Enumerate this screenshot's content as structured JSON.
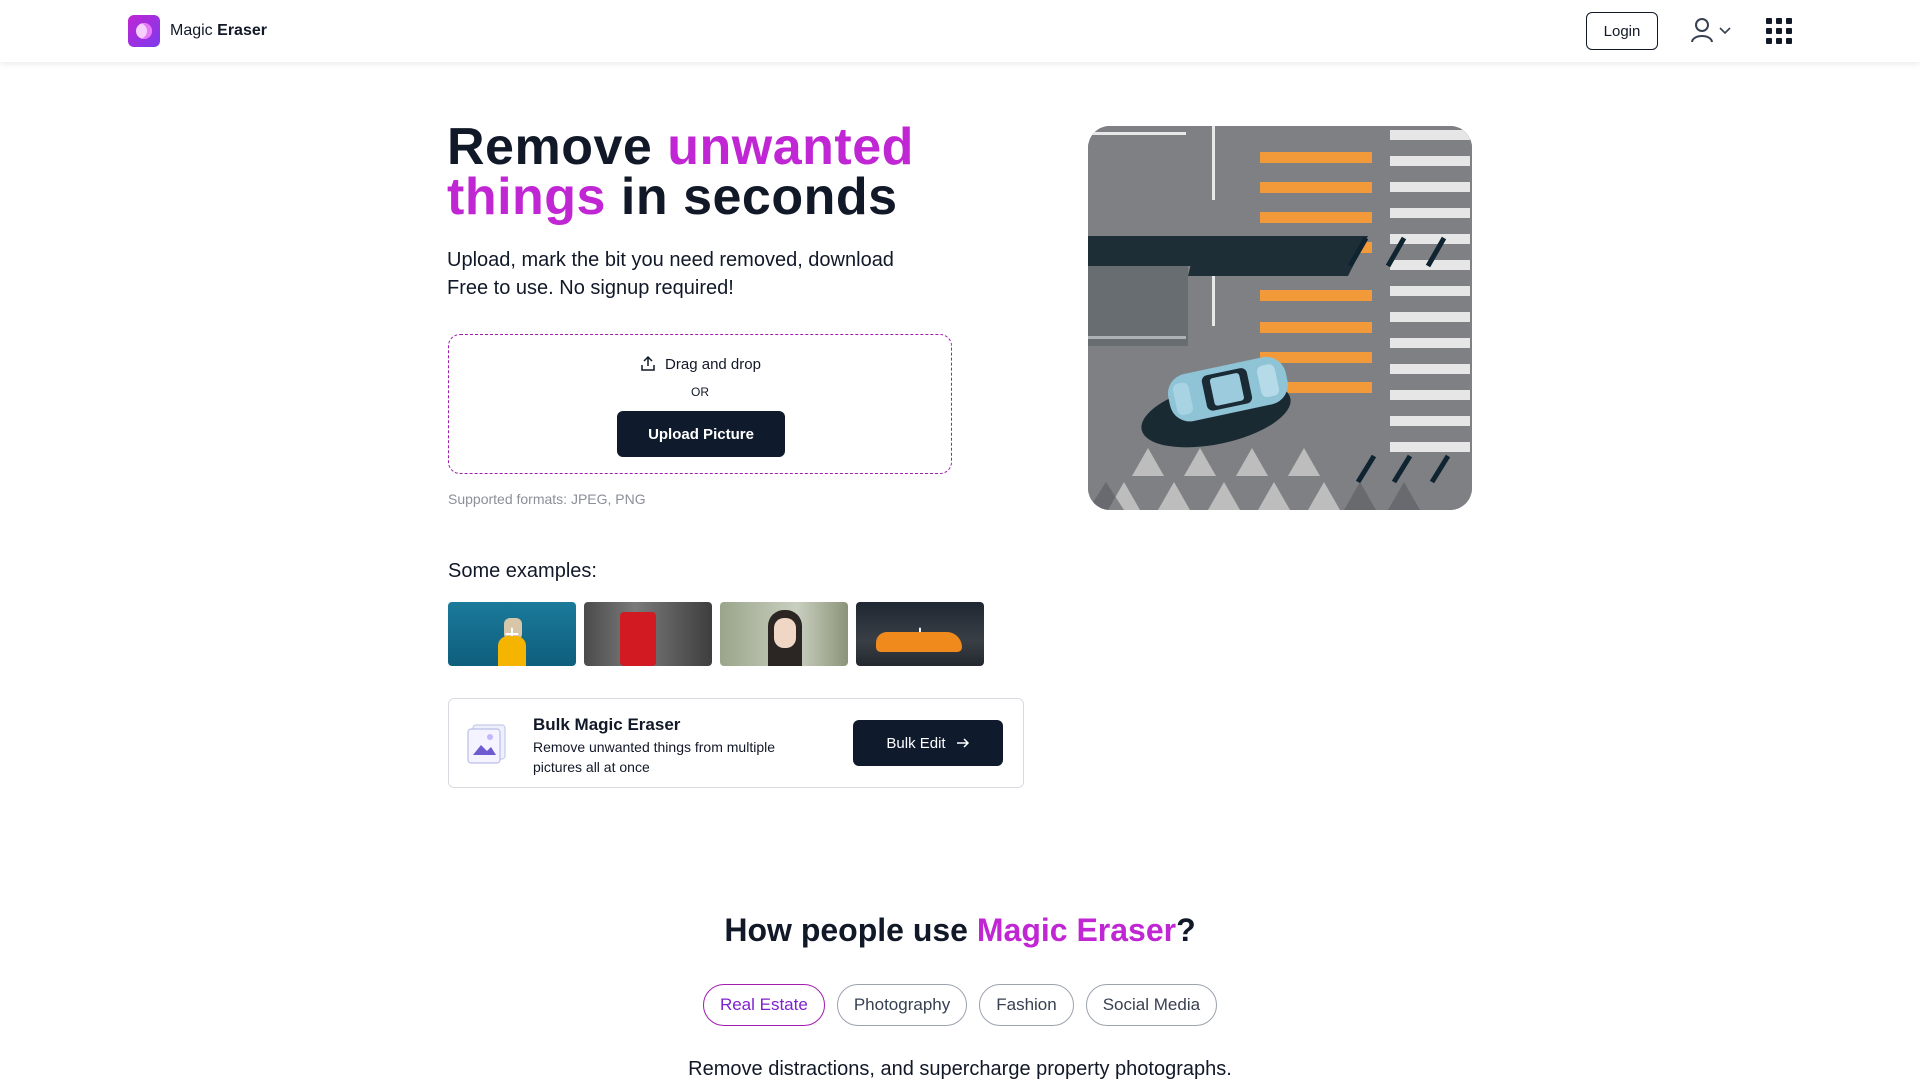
{
  "header": {
    "brand_magic": "Magic",
    "brand_eraser": "Eraser",
    "login_label": "Login"
  },
  "hero": {
    "title_part1": "Remove ",
    "title_accent1": "unwanted",
    "title_accent2": "things",
    "title_part2": " in seconds",
    "subtitle_line1": "Upload, mark the bit you need removed, download",
    "subtitle_line2": "Free to use. No signup required!",
    "drag_label": "Drag and drop",
    "or_label": "OR",
    "upload_label": "Upload Picture",
    "formats": "Supported formats: JPEG, PNG"
  },
  "examples": {
    "title": "Some examples:"
  },
  "bulk": {
    "title": "Bulk Magic Eraser",
    "description": "Remove unwanted things from multiple pictures all at once",
    "button_label": "Bulk Edit"
  },
  "how": {
    "title_part1": "How people use ",
    "title_accent": "Magic Eraser",
    "title_part2": "?",
    "tabs": [
      "Real Estate",
      "Photography",
      "Fashion",
      "Social Media"
    ],
    "active_tab": "Real Estate",
    "description": "Remove distractions, and supercharge property photographs."
  },
  "colors": {
    "accent": "#c026d3",
    "dark_button": "#0f1b2d"
  },
  "icons": [
    "user-icon",
    "chevron-down-icon",
    "apps-grid-icon",
    "upload-icon",
    "plus-icon",
    "gallery-icon",
    "arrow-right-icon"
  ]
}
